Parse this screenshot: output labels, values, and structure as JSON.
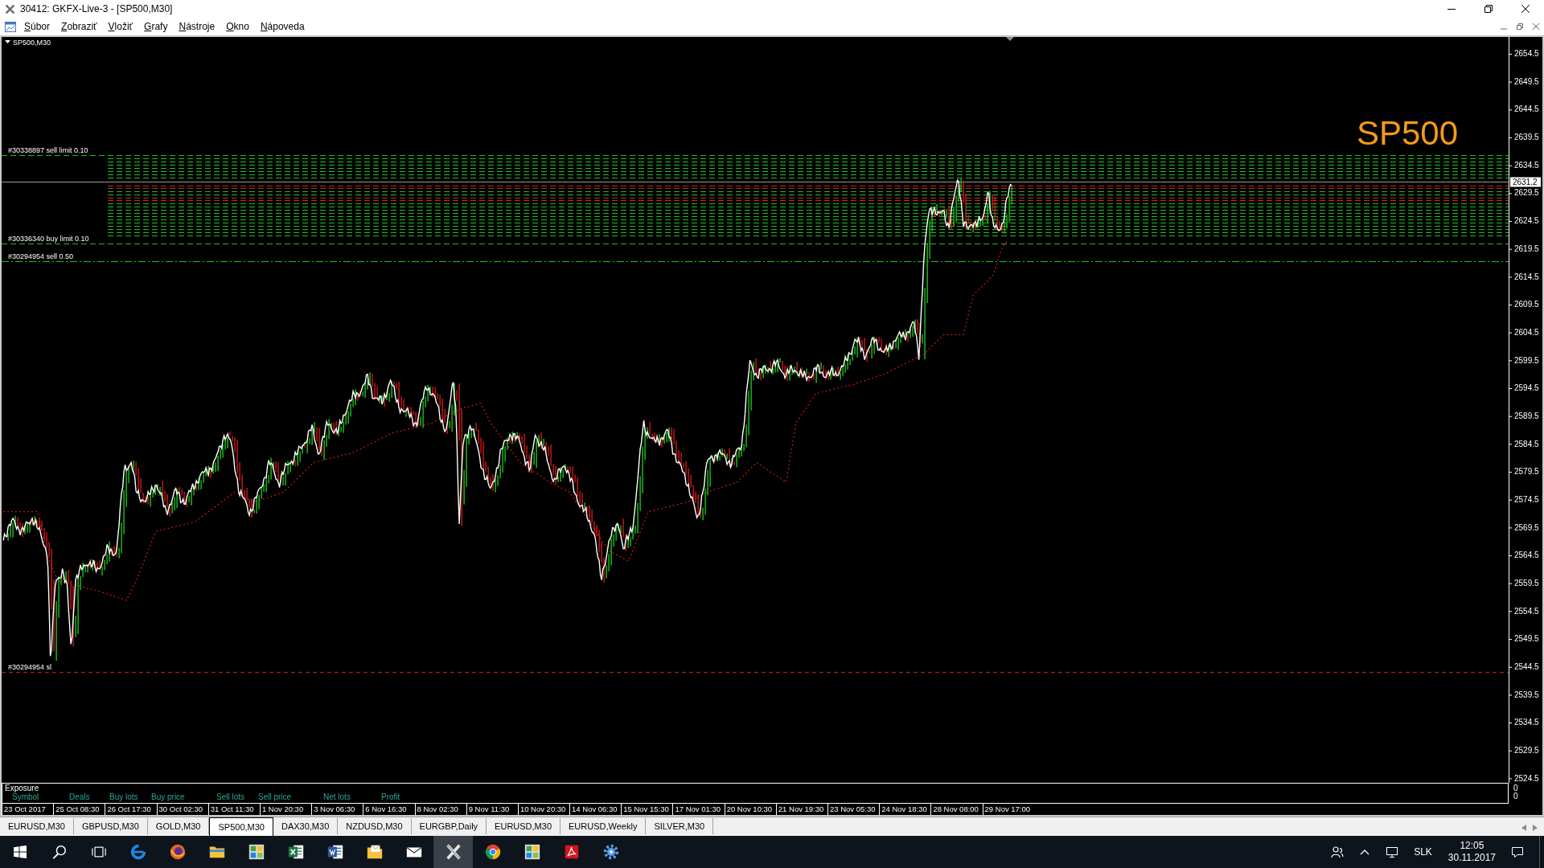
{
  "window": {
    "title": "30412: GKFX-Live-3 - [SP500,M30]"
  },
  "menu": [
    "Súbor",
    "Zobraziť",
    "Vložiť",
    "Grafy",
    "Nástroje",
    "Okno",
    "Nápoveda"
  ],
  "chart": {
    "title": "SP500,M30",
    "symbol": "SP500",
    "current_price": "2631.2",
    "price_axis": [
      "2654.5",
      "2649.5",
      "2644.5",
      "2639.5",
      "2634.5",
      "2629.5",
      "2624.5",
      "2619.5",
      "2614.5",
      "2609.5",
      "2604.5",
      "2599.5",
      "2594.5",
      "2589.5",
      "2584.5",
      "2579.5",
      "2574.5",
      "2569.5",
      "2564.5",
      "2559.5",
      "2554.5",
      "2549.5",
      "2544.5",
      "2539.5",
      "2534.5",
      "2529.5",
      "2524.5"
    ],
    "orders": [
      {
        "label": "#30338897 sell limit 0.10",
        "kind": "pending"
      },
      {
        "label": "#30336340 buy limit 0.10",
        "kind": "pending"
      },
      {
        "label": "#30294954 sell 0.50",
        "kind": "market"
      },
      {
        "label": "#30294954 sl",
        "kind": "stop"
      }
    ],
    "exposure": {
      "title": "Exposure",
      "columns": [
        "Symbol",
        "Deals",
        "Buy lots",
        "Buy price",
        "Sell lots",
        "Sell price",
        "Net lots",
        "Profit"
      ],
      "scale": [
        "0",
        "0"
      ]
    },
    "time_axis": [
      "23 Oct 2017",
      "25 Oct 08:30",
      "26 Oct 17:30",
      "30 Oct 02:30",
      "31 Oct 11:30",
      "1 Nov 20:30",
      "3 Nov 06:30",
      "6 Nov 16:30",
      "8 Nov 02:30",
      "9 Nov 11:30",
      "10 Nov 20:30",
      "14 Nov 06:30",
      "15 Nov 15:30",
      "17 Nov 01:30",
      "20 Nov 10:30",
      "21 Nov 19:30",
      "23 Nov 05:30",
      "24 Nov 18:30",
      "28 Nov 08:00",
      "29 Nov 17:00"
    ]
  },
  "tabs": [
    {
      "label": "EURUSD,M30",
      "selected": false
    },
    {
      "label": "GBPUSD,M30",
      "selected": false
    },
    {
      "label": "GOLD,M30",
      "selected": false
    },
    {
      "label": "SP500,M30",
      "selected": true
    },
    {
      "label": "DAX30,M30",
      "selected": false
    },
    {
      "label": "NZDUSD,M30",
      "selected": false
    },
    {
      "label": "EURGBP,Daily",
      "selected": false
    },
    {
      "label": "EURUSD,M30",
      "selected": false
    },
    {
      "label": "EURUSD,Weekly",
      "selected": false
    },
    {
      "label": "SILVER,M30",
      "selected": false
    }
  ],
  "taskbar": {
    "apps": [
      {
        "kind": "start",
        "selected": false
      },
      {
        "kind": "search",
        "selected": false
      },
      {
        "kind": "taskview",
        "selected": false
      },
      {
        "kind": "ring",
        "selected": false
      },
      {
        "kind": "globe",
        "selected": false
      },
      {
        "kind": "folder",
        "selected": false
      },
      {
        "kind": "tiles",
        "selected": false
      },
      {
        "kind": "sheet",
        "selected": false
      },
      {
        "kind": "document",
        "selected": false
      },
      {
        "kind": "mailfolder",
        "selected": false
      },
      {
        "kind": "envelope",
        "selected": false
      },
      {
        "kind": "terminal",
        "selected": true
      },
      {
        "kind": "wheel",
        "selected": false
      },
      {
        "kind": "tiles",
        "selected": false
      },
      {
        "kind": "pdf",
        "selected": false
      },
      {
        "kind": "gear",
        "selected": false
      }
    ],
    "tray": {
      "language": "SLK",
      "time": "12:05",
      "date": "30.11.2017"
    }
  }
}
